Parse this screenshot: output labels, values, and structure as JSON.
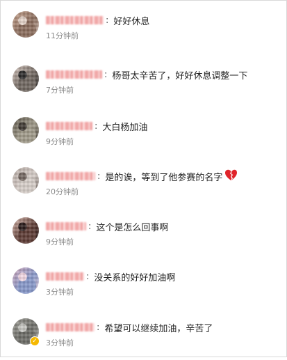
{
  "comments": [
    {
      "text": "好好休息",
      "time": "11分钟前",
      "avatar_colors": [
        "#c8a58f",
        "#8a6b5b",
        "#e3d2c8"
      ],
      "verified": false
    },
    {
      "text": "杨哥太辛苦了，好好休息调整一下",
      "time": "7分钟前",
      "avatar_colors": [
        "#d8c8c0",
        "#6f665f",
        "#2d2b2b"
      ],
      "verified": false
    },
    {
      "text": "大白杨加油",
      "time": "9分钟前",
      "avatar_colors": [
        "#5b5448",
        "#a09a89",
        "#403a33"
      ],
      "verified": false
    },
    {
      "text": "是的诶，等到了他参赛的名字",
      "time": "20分钟前",
      "avatar_colors": [
        "#b4a7a1",
        "#d6cdc8",
        "#736761"
      ],
      "verified": false
    },
    {
      "text": "这个是怎么回事啊",
      "time": "9分钟前",
      "avatar_colors": [
        "#d9b9ae",
        "#5d3b34",
        "#2b1d1c"
      ],
      "verified": false
    },
    {
      "text": "没关系的好好加油啊",
      "time": "3分钟前",
      "avatar_colors": [
        "#d2a8ba",
        "#8697c9",
        "#f1d7e2"
      ],
      "verified": false
    },
    {
      "text": "希望可以继续加油，辛苦了",
      "time": "3分钟前",
      "avatar_colors": [
        "#9d9c95",
        "#6b6b66",
        "#c6c6c1"
      ],
      "verified": true
    }
  ],
  "icons": {
    "broken_heart_color": "#e0242a",
    "verified_badge_color": "#f5b800"
  }
}
